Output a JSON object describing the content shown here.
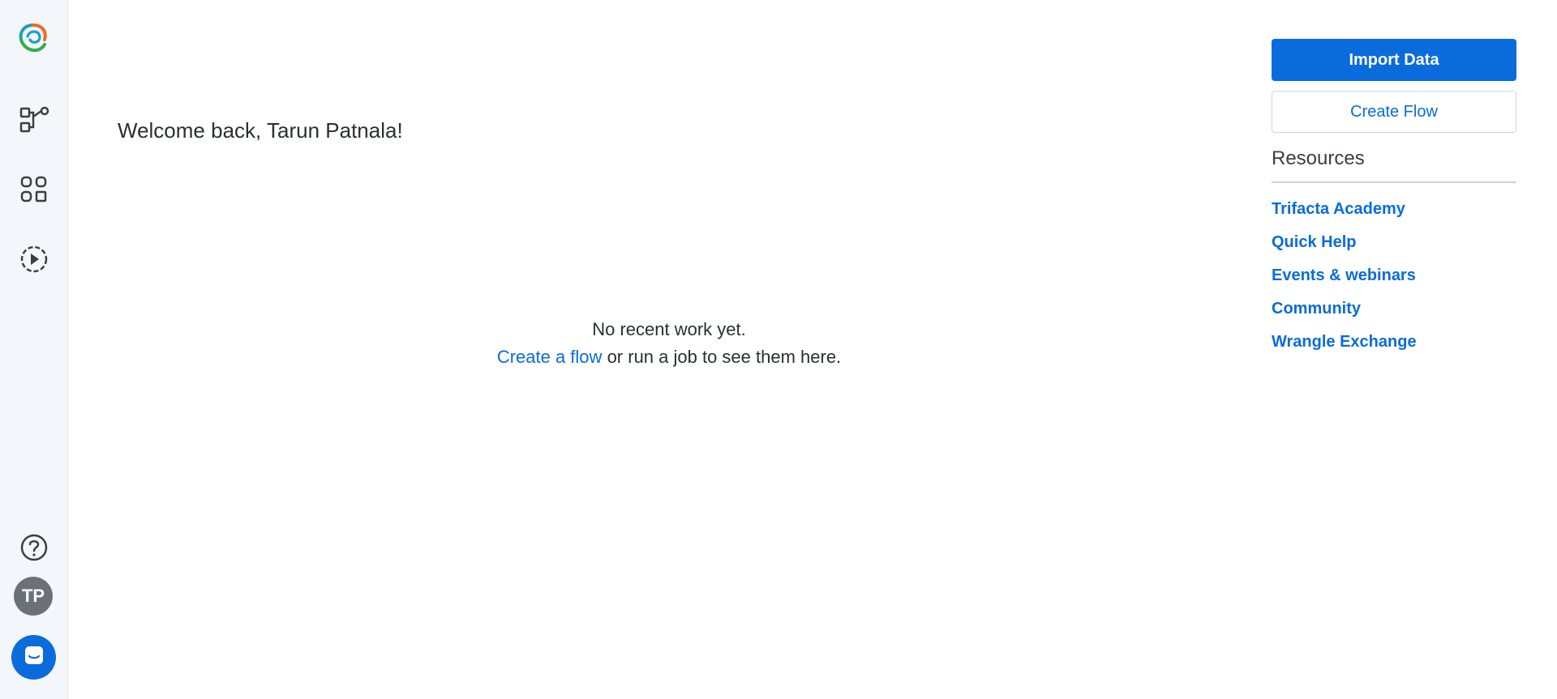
{
  "sidebar": {
    "logo": "trifacta-logo",
    "nav_items": [
      {
        "name": "flows-nav",
        "icon": "flow-icon"
      },
      {
        "name": "library-nav",
        "icon": "grid-icon"
      },
      {
        "name": "jobs-nav",
        "icon": "play-circle-icon"
      }
    ],
    "help_icon": "help-circle-icon",
    "user_initials": "TP",
    "chat_icon": "chat-icon"
  },
  "main": {
    "welcome": "Welcome back, Tarun Patnala!",
    "empty_title": "No recent work yet.",
    "empty_link": "Create a flow",
    "empty_rest": "or run a job to see them here."
  },
  "actions": {
    "import_data": "Import Data",
    "create_flow": "Create Flow"
  },
  "resources": {
    "title": "Resources",
    "links": [
      "Trifacta Academy",
      "Quick Help",
      "Events & webinars",
      "Community",
      "Wrangle Exchange"
    ]
  },
  "colors": {
    "accent": "#0a6bdd",
    "sidebar_bg": "#f3f6fa",
    "avatar_bg": "#6b7178"
  }
}
